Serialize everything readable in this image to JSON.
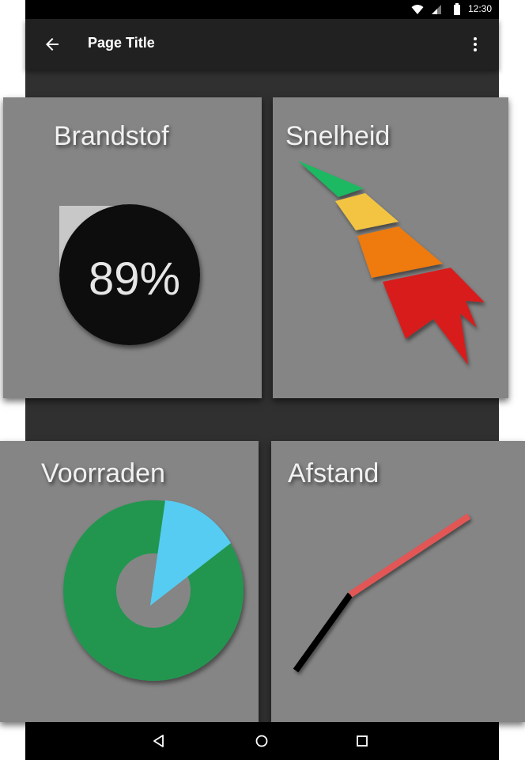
{
  "status_bar": {
    "time": "12:30",
    "icons": [
      "wifi-icon",
      "signal-icon",
      "battery-icon"
    ]
  },
  "app_bar": {
    "title": "Page Title",
    "back_icon": "arrow-left-icon",
    "menu_icon": "more-vert-icon"
  },
  "cards": {
    "fuel": {
      "title": "Brandstof",
      "value_text": "89%",
      "fraction": 0.89
    },
    "speed": {
      "title": "Snelheid",
      "segment_colors": [
        "#1db862",
        "#f2c443",
        "#ef7a10",
        "#d81e1e"
      ]
    },
    "supplies": {
      "title": "Voorraden",
      "fractions": [
        0.85,
        0.15
      ],
      "colors": {
        "main": "#229650",
        "accent": "#56ccf2"
      }
    },
    "distance": {
      "title": "Afstand",
      "colors": {
        "done": "#000000",
        "remaining": "#e25757"
      }
    }
  },
  "nav_bar": {
    "icons": [
      "back-triangle-icon",
      "home-circle-icon",
      "recents-square-icon"
    ]
  }
}
